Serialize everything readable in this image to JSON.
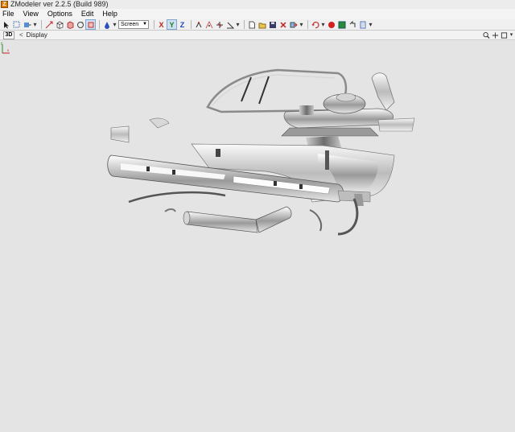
{
  "window": {
    "app_icon": "Z",
    "title": "ZModeler ver 2.2.5 (Build 989)"
  },
  "menu": [
    "File",
    "View",
    "Options",
    "Edit",
    "Help"
  ],
  "toolbar": {
    "coord_space": "Screen",
    "axis_x": "X",
    "axis_y": "Y",
    "axis_z": "Z"
  },
  "view": {
    "mode": "3D",
    "nav_arrow": "<",
    "label": "Display"
  },
  "axis_gizmo": {
    "y": "y",
    "x": "x"
  }
}
